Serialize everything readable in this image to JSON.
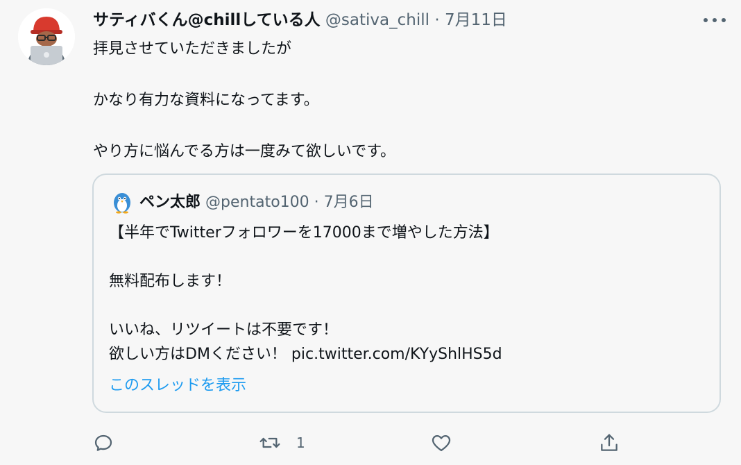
{
  "tweet": {
    "display_name": "サティバくん@chillしている人",
    "handle": "@sativa_chill",
    "separator": "·",
    "date": "7月11日",
    "text": "拝見させていただきましたが\n\nかなり有力な資料になってます。\n\nやり方に悩んでる方は一度みて欲しいです。"
  },
  "quote": {
    "display_name": "ペン太郎",
    "handle": "@pentato100",
    "separator": "·",
    "date": "7月6日",
    "text": "【半年でTwitterフォロワーを17000まで増やした方法】\n\n無料配布します！\n\nいいね、リツイートは不要です！\n欲しい方はDMください！ pic.twitter.com/KYyShlHS5d",
    "show_thread_label": "このスレッドを表示"
  },
  "actions": {
    "retweet_count": "1"
  },
  "icons": {
    "more": "more-horizontal-icon",
    "reply": "reply-icon",
    "retweet": "retweet-icon",
    "like": "heart-icon",
    "share": "share-icon"
  },
  "colors": {
    "text": "#0f1419",
    "secondary": "#536471",
    "link": "#1d9bf0",
    "border": "#cfd9de",
    "background": "#f7f7f7"
  }
}
